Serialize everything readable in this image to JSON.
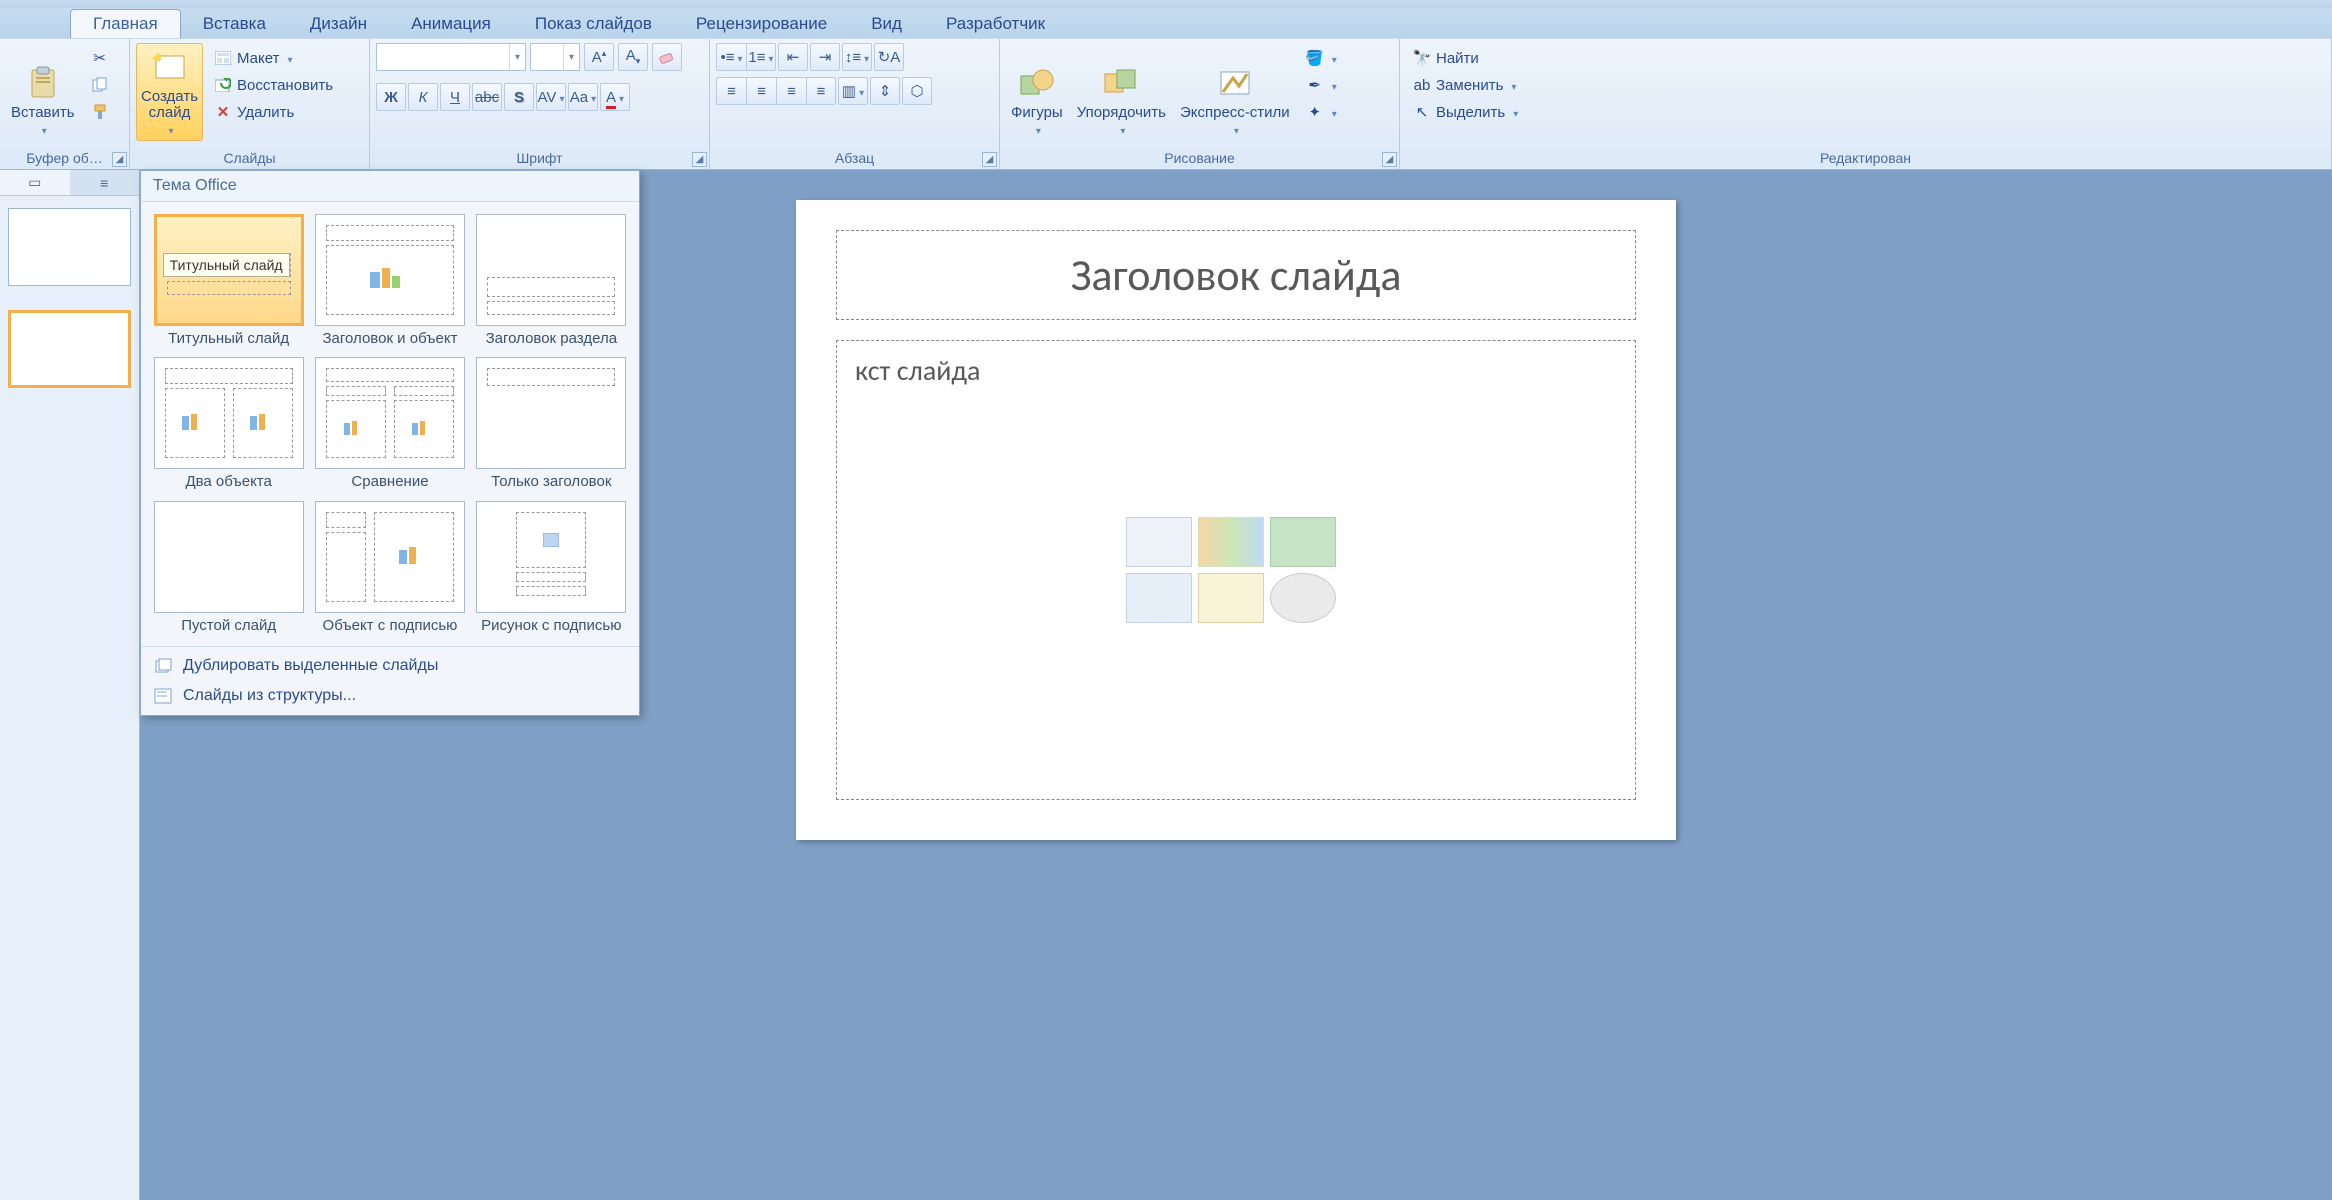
{
  "tabs": [
    "Главная",
    "Вставка",
    "Дизайн",
    "Анимация",
    "Показ слайдов",
    "Рецензирование",
    "Вид",
    "Разработчик"
  ],
  "active_tab": 0,
  "groups": {
    "clipboard": {
      "label": "Буфер об…",
      "paste": "Вставить"
    },
    "slides": {
      "label": "Слайды",
      "new": "Создать\nслайд",
      "layout": "Макет",
      "reset": "Восстановить",
      "delete": "Удалить"
    },
    "font": {
      "label": "Шрифт"
    },
    "paragraph": {
      "label": "Абзац"
    },
    "drawing": {
      "label": "Рисование",
      "shapes": "Фигуры",
      "arrange": "Упорядочить",
      "styles": "Экспресс-стили"
    },
    "editing": {
      "label": "Редактирован",
      "find": "Найти",
      "replace": "Заменить",
      "select": "Выделить"
    }
  },
  "gallery": {
    "header": "Тема Office",
    "items": [
      {
        "cap": "Титульный слайд",
        "sel": true,
        "tooltip": "Титульный слайд"
      },
      {
        "cap": "Заголовок и объект"
      },
      {
        "cap": "Заголовок раздела"
      },
      {
        "cap": "Два объекта"
      },
      {
        "cap": "Сравнение"
      },
      {
        "cap": "Только заголовок"
      },
      {
        "cap": "Пустой слайд"
      },
      {
        "cap": "Объект с подписью"
      },
      {
        "cap": "Рисунок с подписью"
      }
    ],
    "menu": [
      "Дублировать выделенные слайды",
      "Слайды из структуры..."
    ]
  },
  "thumbs": {
    "count": 2,
    "selected": 2
  },
  "slide": {
    "title": "Заголовок слайда",
    "body_partial": "кст слайда"
  }
}
